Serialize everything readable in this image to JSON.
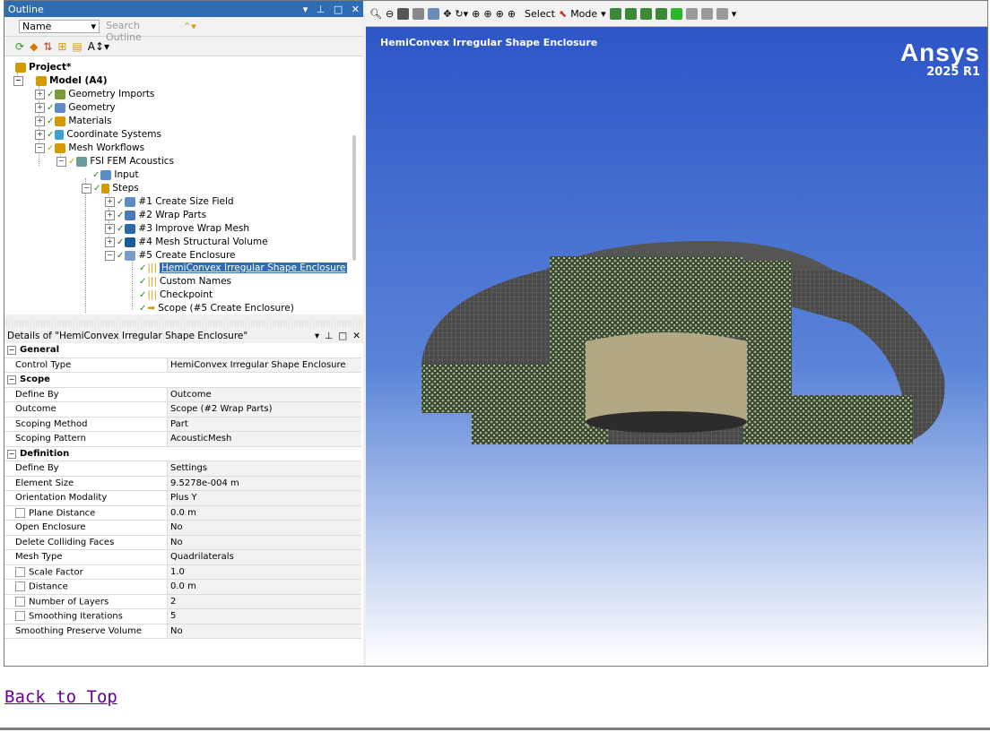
{
  "outline": {
    "title": "Outline",
    "name_combo": "Name",
    "search_placeholder": "Search Outline",
    "tree": {
      "project": "Project*",
      "model": "Model (A4)",
      "geometry_imports": "Geometry Imports",
      "geometry": "Geometry",
      "materials": "Materials",
      "coordinate_systems": "Coordinate Systems",
      "mesh_workflows": "Mesh Workflows",
      "fsi": "FSI FEM Acoustics",
      "input": "Input",
      "steps": "Steps",
      "step1": "#1 Create Size Field",
      "step2": "#2 Wrap Parts",
      "step3": "#3 Improve Wrap Mesh",
      "step4": "#4 Mesh Structural Volume",
      "step5": "#5 Create Enclosure",
      "hemi": "HemiConvex Irregular Shape Enclosure",
      "custom_names": "Custom Names",
      "checkpoint": "Checkpoint",
      "scope": "Scope (#5 Create Enclosure)"
    }
  },
  "details": {
    "title": "Details of \"HemiConvex Irregular Shape Enclosure\"",
    "groups": {
      "general": "General",
      "scope": "Scope",
      "definition": "Definition"
    },
    "rows": {
      "control_type": [
        "Control Type",
        "HemiConvex Irregular Shape Enclosure"
      ],
      "scope_define_by": [
        "Define By",
        "Outcome"
      ],
      "outcome": [
        "Outcome",
        "Scope (#2 Wrap Parts)"
      ],
      "scoping_method": [
        "Scoping Method",
        "Part"
      ],
      "scoping_pattern": [
        "Scoping Pattern",
        "AcousticMesh"
      ],
      "def_define_by": [
        "Define By",
        "Settings"
      ],
      "element_size": [
        "Element Size",
        "9.5278e-004 m"
      ],
      "orientation": [
        "Orientation Modality",
        "Plus Y"
      ],
      "plane_distance": [
        "Plane Distance",
        "0.0 m"
      ],
      "open_enclosure": [
        "Open Enclosure",
        "No"
      ],
      "delete_colliding": [
        "Delete Colliding Faces",
        "No"
      ],
      "mesh_type": [
        "Mesh Type",
        "Quadrilaterals"
      ],
      "scale_factor": [
        "Scale Factor",
        "1.0"
      ],
      "distance": [
        "Distance",
        "0.0 m"
      ],
      "num_layers": [
        "Number of Layers",
        "2"
      ],
      "smoothing_iter": [
        "Smoothing Iterations",
        "5"
      ],
      "smoothing_preserve": [
        "Smoothing Preserve Volume",
        "No"
      ]
    }
  },
  "viewport": {
    "title": "HemiConvex Irregular Shape Enclosure",
    "brand": "Ansys",
    "release": "2025 R1",
    "toolbar": {
      "select": "Select",
      "mode": "Mode"
    }
  },
  "footer": {
    "back_to_top": "Back to Top"
  },
  "colors": {
    "accent": "#2f6db3",
    "link": "#660099"
  }
}
